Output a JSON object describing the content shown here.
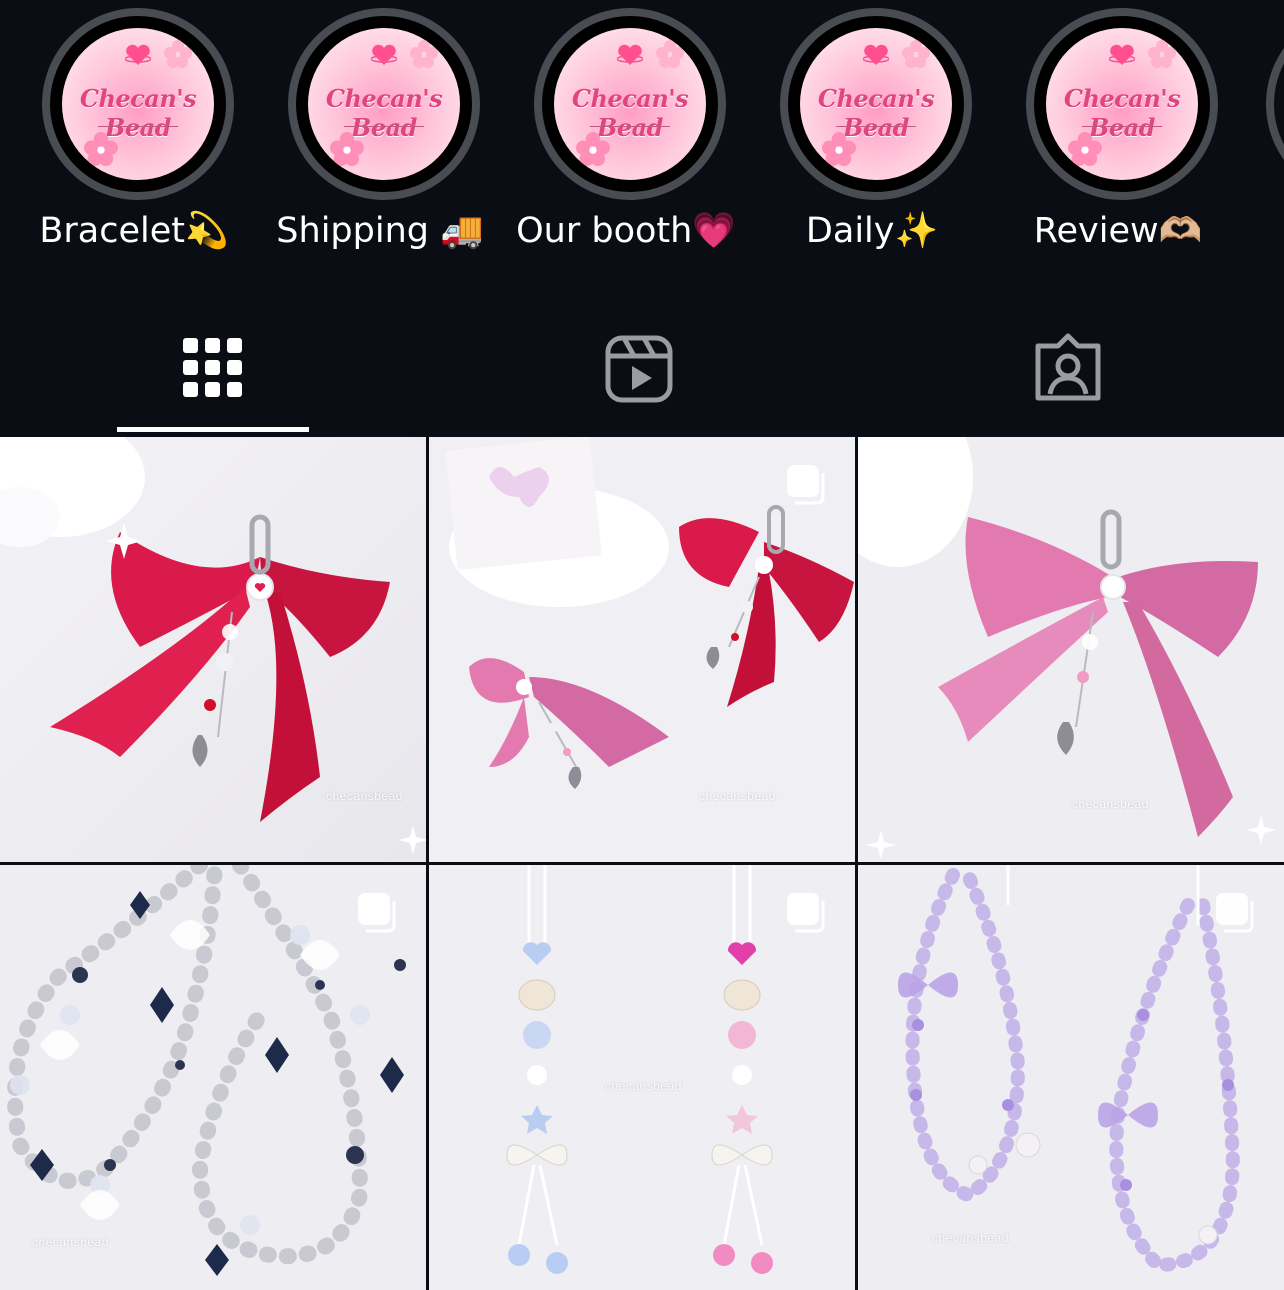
{
  "highlights": [
    {
      "label": "Bracelet💫",
      "cover_text": "Checan's Bead"
    },
    {
      "label": "Shipping 🚚",
      "cover_text": "Checan's Bead"
    },
    {
      "label": "Our booth💗",
      "cover_text": "Checan's Bead"
    },
    {
      "label": "Daily✨",
      "cover_text": "Checan's Bead"
    },
    {
      "label": "Review🫶🏼",
      "cover_text": "Checan's Bead"
    }
  ],
  "tabs": [
    {
      "name": "grid",
      "icon": "grid-icon",
      "selected": true
    },
    {
      "name": "reels",
      "icon": "reels-icon",
      "selected": false
    },
    {
      "name": "tagged",
      "icon": "tagged-icon",
      "selected": false
    }
  ],
  "posts": [
    {
      "subject": "red-bow-keychain",
      "watermark": "checansbead",
      "carousel": false
    },
    {
      "subject": "pink-and-red-bow-keychains",
      "watermark": "checansbead",
      "carousel": true
    },
    {
      "subject": "pink-bow-keychain",
      "watermark": "checansbead",
      "carousel": false
    },
    {
      "subject": "black-crystal-phone-straps",
      "watermark": "checansbead",
      "carousel": true
    },
    {
      "subject": "heart-shell-phone-straps",
      "watermark": "checansbead",
      "carousel": true
    },
    {
      "subject": "lavender-bead-phone-straps",
      "watermark": "checansbead",
      "carousel": true
    }
  ],
  "colors": {
    "background": "#0b0d14",
    "ring": "#4a4c54",
    "red_ribbon": "#d91a4a",
    "pink_ribbon": "#e27ab0",
    "lavender": "#b9a3e6"
  }
}
